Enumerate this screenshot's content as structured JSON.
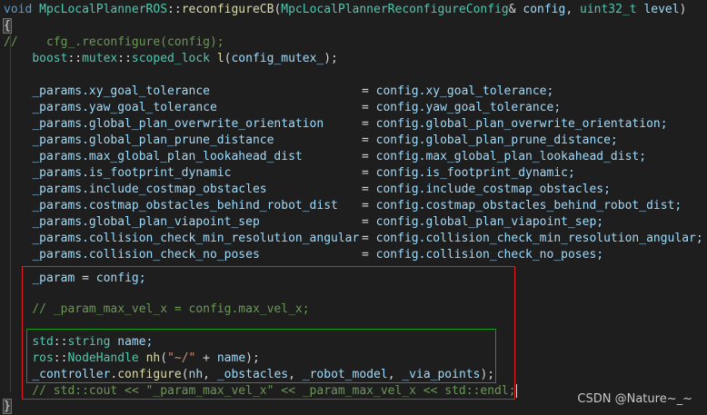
{
  "code": {
    "l01": {
      "void": "void",
      "cls": "MpcLocalPlannerROS",
      "sep": "::",
      "fn": "reconfigureCB",
      "p1": "(",
      "ptype": "MpcLocalPlannerReconfigureConfig",
      "amp": "& ",
      "pconfig": "config",
      ", ": ", ",
      "ptype2": "uint32_t",
      "sp": " ",
      "plevel": "level",
      "p2": ")"
    },
    "l02": {
      "brace": "{"
    },
    "l03": {
      "comment": "//    cfg_.reconfigure(config);"
    },
    "l04": {
      "ns": "boost",
      "s1": "::",
      "ns2": "mutex",
      "s2": "::",
      "t": "scoped_lock",
      "sp": " ",
      "fn": "l",
      "p1": "(",
      "v": "config_mutex_",
      "p2": ");"
    },
    "params": [
      {
        "lhs": "_params.xy_goal_tolerance",
        "rhs": "config.xy_goal_tolerance;"
      },
      {
        "lhs": "_params.yaw_goal_tolerance",
        "rhs": "config.yaw_goal_tolerance;"
      },
      {
        "lhs": "_params.global_plan_overwrite_orientation",
        "rhs": "config.global_plan_overwrite_orientation;"
      },
      {
        "lhs": "_params.global_plan_prune_distance",
        "rhs": "config.global_plan_prune_distance;"
      },
      {
        "lhs": "_params.max_global_plan_lookahead_dist",
        "rhs": "config.max_global_plan_lookahead_dist;"
      },
      {
        "lhs": "_params.is_footprint_dynamic",
        "rhs": "config.is_footprint_dynamic;"
      },
      {
        "lhs": "_params.include_costmap_obstacles",
        "rhs": "config.include_costmap_obstacles;"
      },
      {
        "lhs": "_params.costmap_obstacles_behind_robot_dist",
        "rhs": "config.costmap_obstacles_behind_robot_dist;"
      },
      {
        "lhs": "_params.global_plan_viapoint_sep",
        "rhs": "config.global_plan_viapoint_sep;"
      },
      {
        "lhs": "_params.collision_check_min_resolution_angular",
        "rhs": "config.collision_check_min_resolution_angular;"
      },
      {
        "lhs": "_params.collision_check_no_poses",
        "rhs": "config.collision_check_no_poses;"
      }
    ],
    "eq": "= ",
    "l17": {
      "v": "_param",
      "op": " = ",
      "rhs": "config;"
    },
    "l19": {
      "comment": "// _param_max_vel_x = config.max_vel_x;"
    },
    "l21": {
      "ns": "std",
      "s": "::",
      "t": "string",
      "sp": " ",
      "v": "name;"
    },
    "l22": {
      "ns": "ros",
      "s": "::",
      "t": "NodeHandle",
      "sp": " ",
      "fn": "nh",
      "p1": "(",
      "str": "\"~/\"",
      "plus": " + ",
      "v": "name",
      "p2": ");"
    },
    "l23": {
      "obj": "_controller",
      "dot": ".",
      "fn": "configure",
      "p1": "(",
      "a1": "nh",
      ", ": ", ",
      "a2": "_obstacles",
      "a3": "_robot_model",
      "a4": "_via_points",
      "p2": ");"
    },
    "l24": {
      "comment": "// std::cout << \"_param_max_vel_x\" << _param_max_vel_x << std::endl;"
    },
    "l25": {
      "brace": "}"
    }
  },
  "watermark": "CSDN @Nature~_~",
  "colors": {
    "red_box": "#e02020",
    "green_box": "#14a014",
    "background": "#1e1e1e"
  }
}
